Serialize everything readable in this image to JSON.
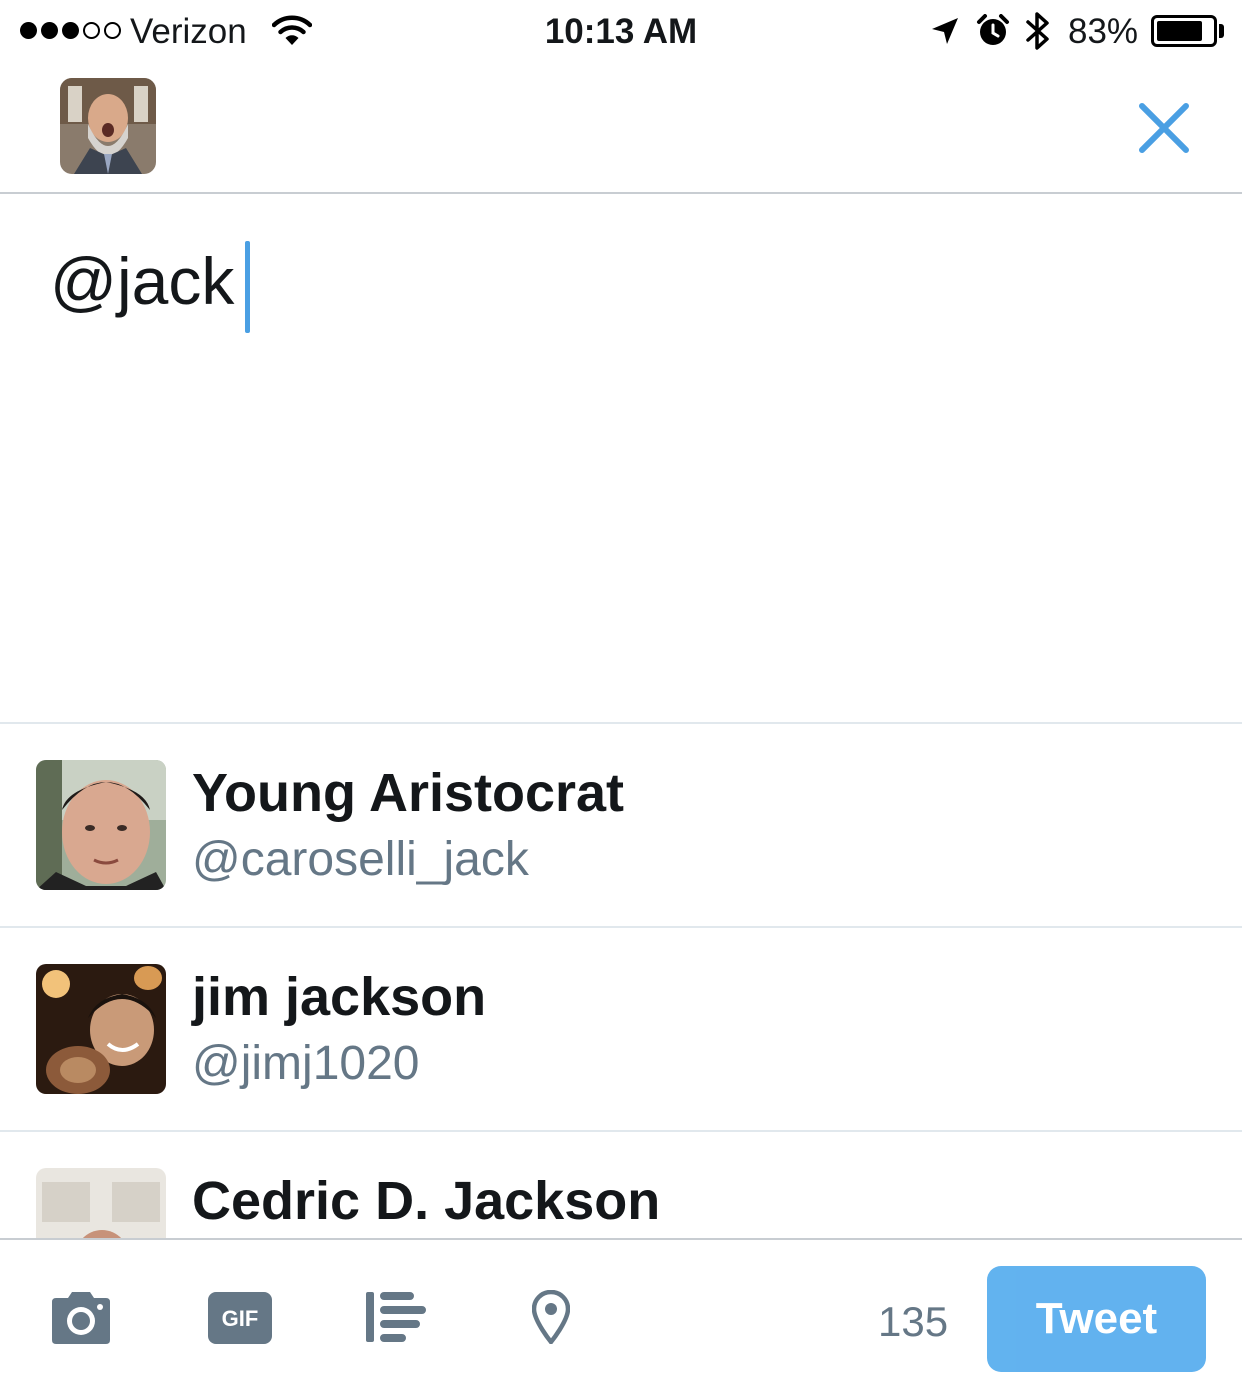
{
  "status_bar": {
    "carrier": "Verizon",
    "signal_bars_filled": 3,
    "signal_bars_total": 5,
    "time": "10:13 AM",
    "battery_percent": "83%",
    "battery_level": 0.83,
    "icons": [
      "wifi-icon",
      "location-arrow-icon",
      "alarm-clock-icon",
      "bluetooth-icon",
      "battery-icon"
    ]
  },
  "header": {
    "avatar_icon": "user-avatar",
    "close_icon": "close-icon",
    "accent_color": "#4a9fe3"
  },
  "compose": {
    "text": "@jack"
  },
  "suggestions": [
    {
      "name": "Young Aristocrat",
      "handle": "@caroselli_jack"
    },
    {
      "name": "jim jackson",
      "handle": "@jimj1020"
    },
    {
      "name": "Cedric D. Jackson",
      "handle": ""
    }
  ],
  "toolbar": {
    "icons": [
      "camera-icon",
      "gif-icon",
      "poll-icon",
      "location-pin-icon"
    ],
    "gif_label": "GIF",
    "char_count": "135",
    "tweet_label": "Tweet",
    "tweet_color": "#55acee"
  }
}
